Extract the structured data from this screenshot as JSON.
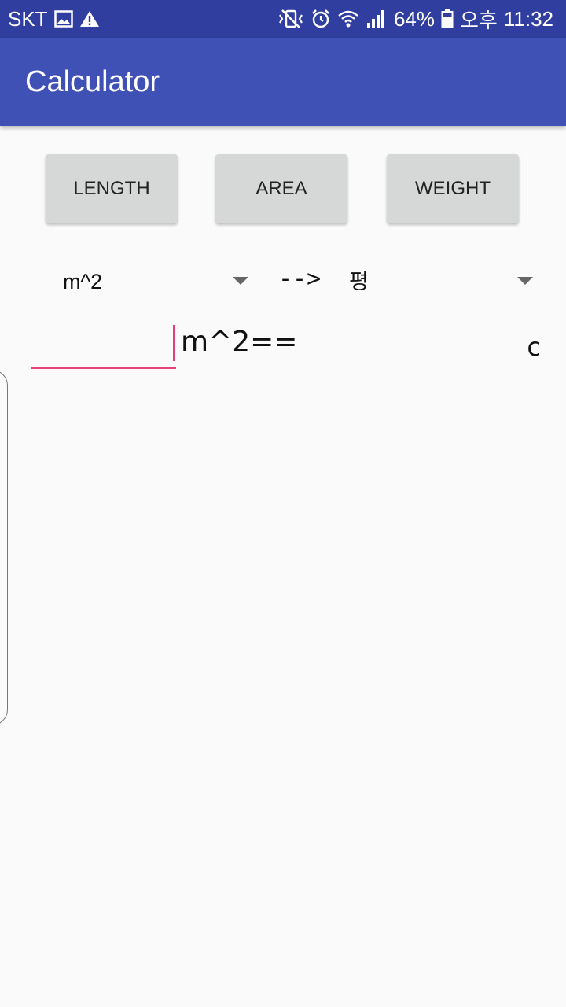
{
  "status_bar": {
    "carrier": "SKT",
    "battery_percent": "64%",
    "time_period": "오후",
    "time": "11:32",
    "icons": [
      "image-icon",
      "warning-icon",
      "mute-vibrate-icon",
      "alarm-icon",
      "wifi-icon",
      "signal-icon",
      "battery-icon"
    ]
  },
  "app_bar": {
    "title": "Calculator"
  },
  "modes": [
    {
      "label": "LENGTH"
    },
    {
      "label": "AREA"
    },
    {
      "label": "WEIGHT"
    }
  ],
  "converter": {
    "from_unit": "m^2",
    "arrow": "-->",
    "to_unit": "평",
    "input_value": "",
    "unit_equals": "m^2==",
    "result": "c"
  }
}
